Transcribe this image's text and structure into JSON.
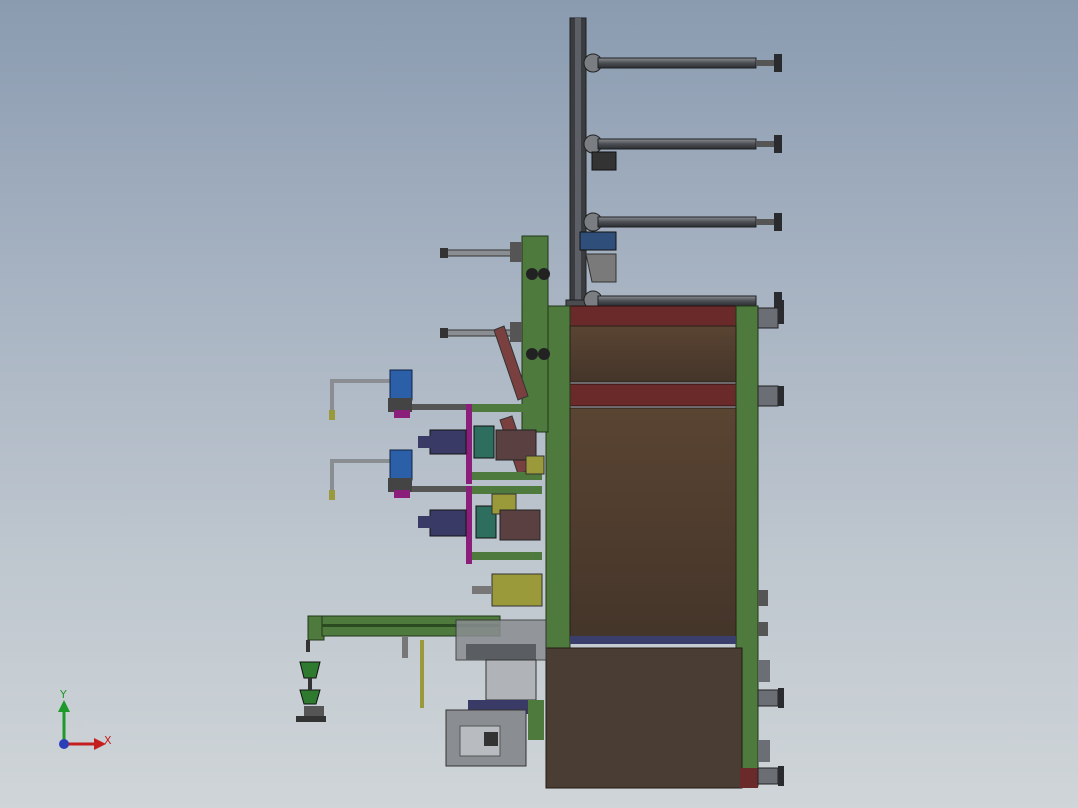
{
  "triad": {
    "x_label": "X",
    "y_label": "Y"
  },
  "colors": {
    "frame_green": "#4f7a3e",
    "panel_brown": "#4a3a2c",
    "rail_red": "#6a2a2a",
    "motor_blue": "#2b5fa8",
    "magenta": "#8a1e7a",
    "olive": "#9a9a3a",
    "steel": "#6b6f75",
    "dark": "#2e2f33"
  }
}
